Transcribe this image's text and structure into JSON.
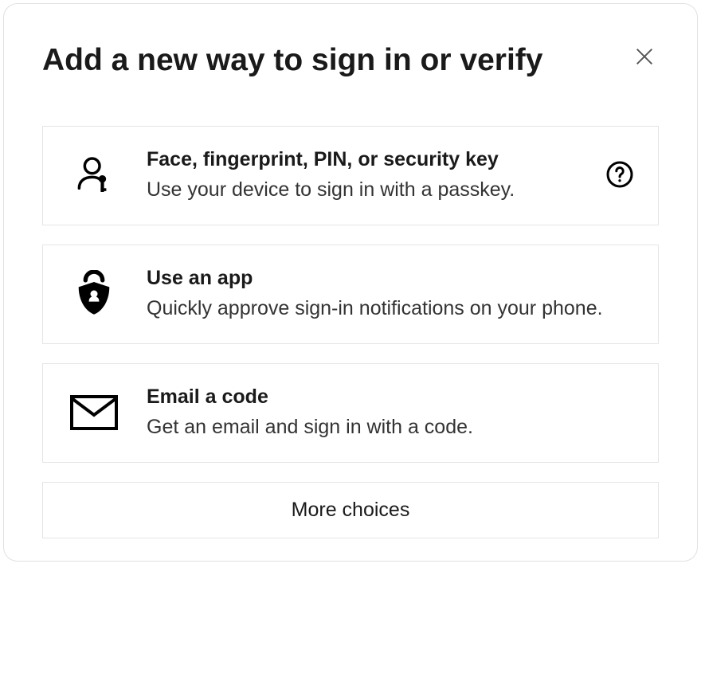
{
  "dialog": {
    "title": "Add a new way to sign in or verify",
    "more_choices_label": "More choices"
  },
  "options": [
    {
      "icon": "passkey-icon",
      "title": "Face, fingerprint, PIN, or security key",
      "description": "Use your device to sign in with a passkey.",
      "has_help": true
    },
    {
      "icon": "authenticator-app-icon",
      "title": "Use an app",
      "description": "Quickly approve sign-in notifications on your phone.",
      "has_help": false
    },
    {
      "icon": "email-icon",
      "title": "Email a code",
      "description": "Get an email and sign in with a  code.",
      "has_help": false
    }
  ]
}
